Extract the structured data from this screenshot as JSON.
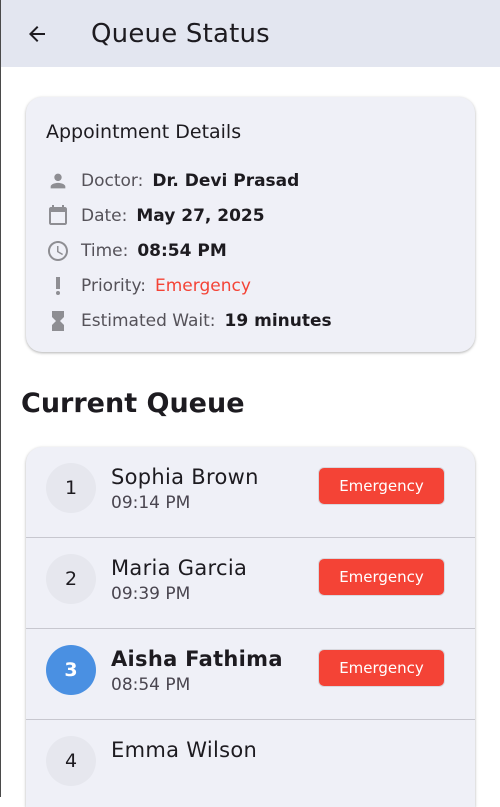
{
  "app_bar": {
    "title": "Queue Status",
    "back_icon": "arrow-back-icon"
  },
  "appointment": {
    "title": "Appointment Details",
    "rows": [
      {
        "icon": "person-icon",
        "label": "Doctor:",
        "value": "Dr. Devi Prasad"
      },
      {
        "icon": "calendar-icon",
        "label": "Date:",
        "value": "May 27, 2025"
      },
      {
        "icon": "clock-icon",
        "label": "Time:",
        "value": "08:54 PM"
      },
      {
        "icon": "priority-high-icon",
        "label": "Priority:",
        "value": "Emergency"
      },
      {
        "icon": "hourglass-icon",
        "label": "Estimated Wait:",
        "value": "19 minutes"
      }
    ]
  },
  "queue": {
    "title": "Current Queue",
    "items": [
      {
        "position": "1",
        "name": "Sophia Brown",
        "time": "09:14 PM",
        "priority": "Emergency",
        "current": false
      },
      {
        "position": "2",
        "name": "Maria Garcia",
        "time": "09:39 PM",
        "priority": "Emergency",
        "current": false
      },
      {
        "position": "3",
        "name": "Aisha Fathima",
        "time": "08:54 PM",
        "priority": "Emergency",
        "current": true
      },
      {
        "position": "4",
        "name": "Emma Wilson",
        "time": "",
        "priority": "",
        "current": false
      }
    ]
  },
  "colors": {
    "app_bar": "#e3e6f0",
    "card": "#eff0f7",
    "emergency": "#f44336",
    "current_position": "#4a90e2"
  }
}
